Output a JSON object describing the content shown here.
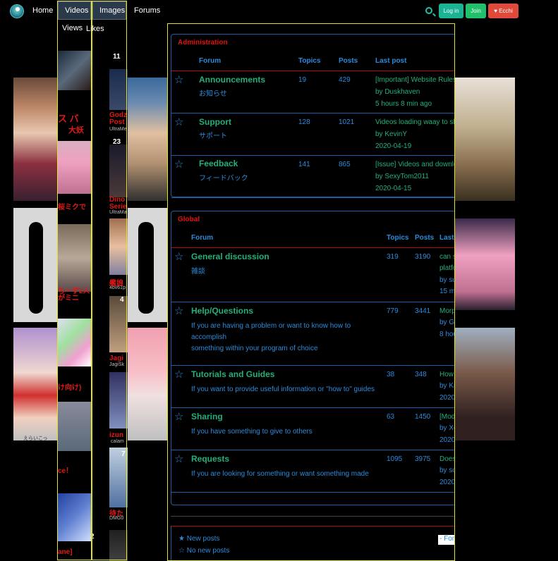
{
  "nav": {
    "home": "Home",
    "videos": "Videos",
    "images": "Images",
    "forums": "Forums",
    "views": "Views",
    "likes": "Likes",
    "login": "Log in",
    "join": "Join",
    "ecchi": "Ecchi"
  },
  "bg": {
    "t1": "ス バ",
    "t2": "大妖",
    "t3": "Godz",
    "t4": "Post",
    "t5": "UltraMe",
    "t6": "23",
    "t7": "11",
    "t8": "桜ミクで",
    "t9": "Dino",
    "t10": "Serie",
    "t11": "UltraMa",
    "t12": "ちーず2人",
    "t13": "がミニ",
    "t14": "4bv61p",
    "t15": "艦娘",
    "t16": "4",
    "t17": "け向け)",
    "t18": "Jagi",
    "t19": "JagiSk",
    "t20": "izun",
    "t21": "calam",
    "t22": "ce！",
    "t23": "7",
    "t24": "待た",
    "t25": "DMG0",
    "t26": "ane]",
    "t27": "2",
    "t28": "えらいこっ"
  },
  "admin": {
    "title": "Administration",
    "headers": {
      "forum": "Forum",
      "topics": "Topics",
      "posts": "Posts",
      "last": "Last post"
    },
    "rows": [
      {
        "name": "Announcements",
        "sub": "お知らせ",
        "topics": "19",
        "posts": "429",
        "lp1": "[Important] Website Rules",
        "lp2": "by Duskhaven",
        "lp3": "5 hours 8 min ago"
      },
      {
        "name": "Support",
        "sub": "サポート",
        "topics": "128",
        "posts": "1021",
        "lp1": "Videos loading waay to slo",
        "lp2": "by KevinY",
        "lp3": "2020-04-19"
      },
      {
        "name": "Feedback",
        "sub": "フィードバック",
        "topics": "141",
        "posts": "865",
        "lp1": "[Issue] Videos and downlo",
        "lp2": "by SexyTom2011",
        "lp3": "2020-04-15"
      }
    ]
  },
  "global": {
    "title": "Global",
    "headers": {
      "forum": "Forum",
      "topics": "Topics",
      "posts": "Posts",
      "last": "Last"
    },
    "rows": [
      {
        "name": "General discussion",
        "sub1": "雑談",
        "sub2": "",
        "sub3": "",
        "topics": "319",
        "posts": "3190",
        "lp1": "can s",
        "lp2": "platfo",
        "lp3": "by su",
        "lp4": "15 m"
      },
      {
        "name": "Help/Questions",
        "sub1": "If you are having a problem or want to know how to",
        "sub2": "accomplish",
        "sub3": "something within your program of choice",
        "topics": "779",
        "posts": "3441",
        "lp1": "Morp",
        "lp2": "by G",
        "lp3": "8 hou",
        "lp4": ""
      },
      {
        "name": "Tutorials and Guides",
        "sub1": "If you want to provide useful information or \"how to\" guides",
        "sub2": "",
        "sub3": "",
        "topics": "38",
        "posts": "348",
        "lp1": "How",
        "lp2": "by Kn",
        "lp3": "2020",
        "lp4": ""
      },
      {
        "name": "Sharing",
        "sub1": "If you have something to give to others",
        "sub2": "",
        "sub3": "",
        "topics": "63",
        "posts": "1450",
        "lp1": "[Mod",
        "lp2": "by Xe",
        "lp3": "2020",
        "lp4": ""
      },
      {
        "name": "Requests",
        "sub1": "If you are looking for something or want something made",
        "sub2": "",
        "sub3": "",
        "topics": "1095",
        "posts": "3975",
        "lp1": "Does",
        "lp2": "by so",
        "lp3": "2020",
        "lp4": ""
      }
    ]
  },
  "legend": {
    "new": "New posts",
    "nonew": "No new posts",
    "select": "- For"
  }
}
